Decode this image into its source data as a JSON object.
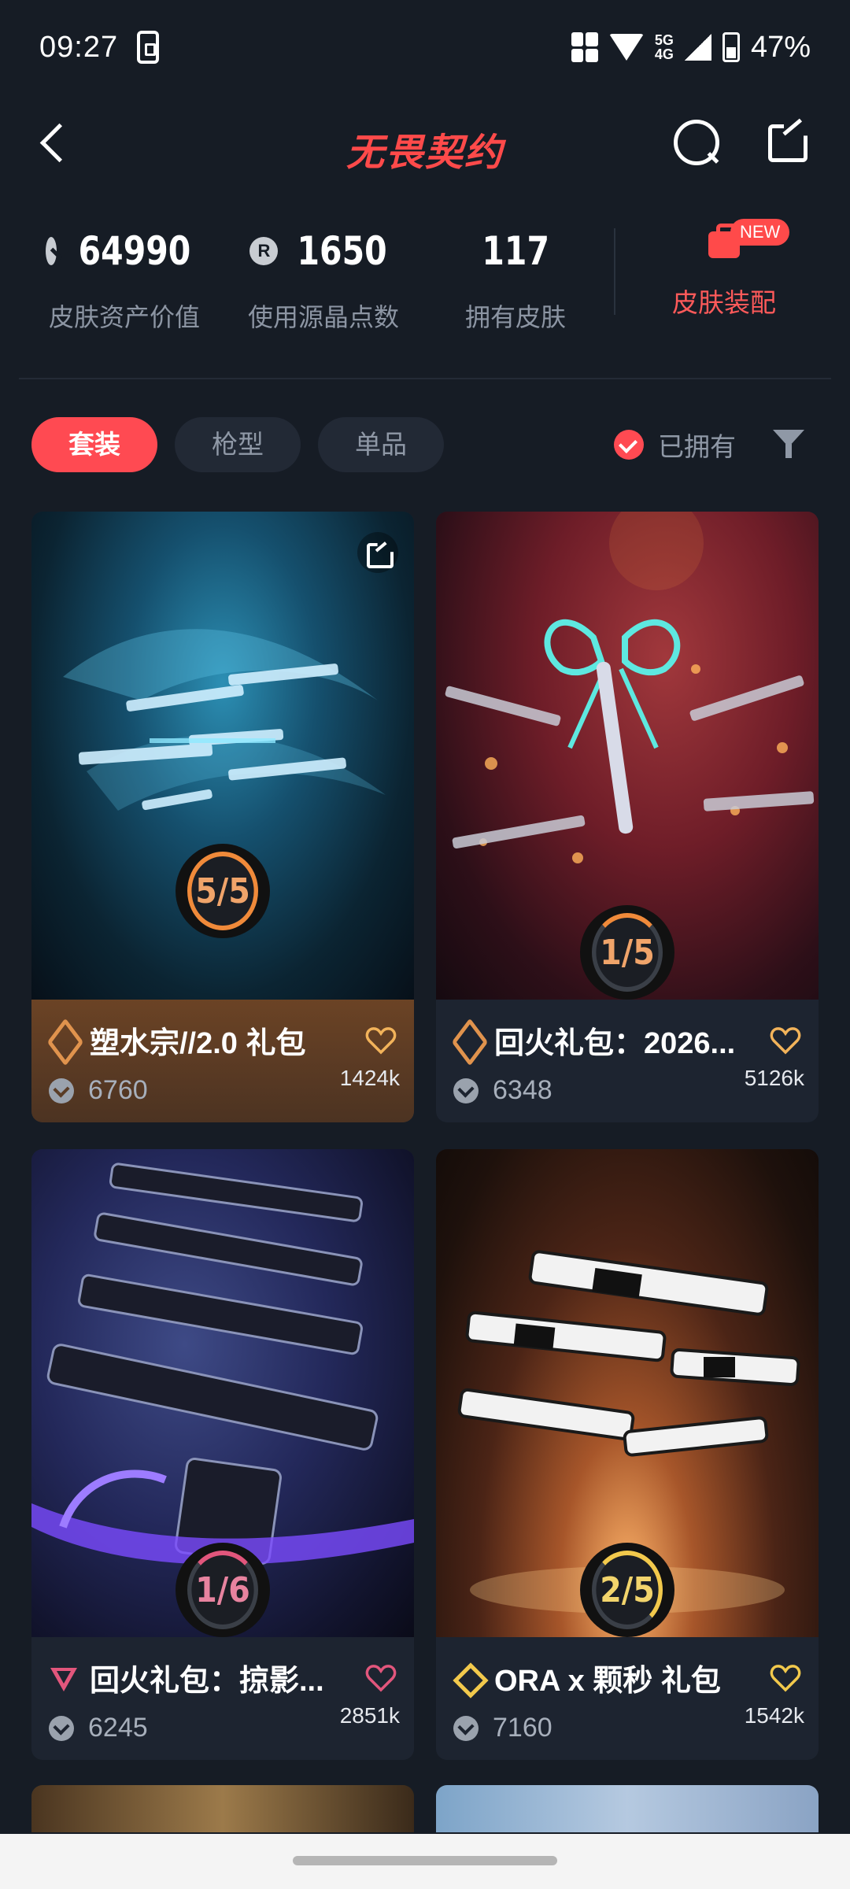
{
  "status_bar": {
    "time": "09:27",
    "battery": "47%",
    "net_top": "5G",
    "net_bottom": "4G"
  },
  "header": {
    "logo": "无畏契约"
  },
  "stats": {
    "asset_value": "64990",
    "asset_label": "皮肤资产价值",
    "rp_points": "1650",
    "rp_label": "使用源晶点数",
    "owned_skins": "117",
    "owned_label": "拥有皮肤",
    "loadout_label": "皮肤装配",
    "new_badge": "NEW"
  },
  "filters": {
    "tabs": [
      {
        "label": "套装",
        "active": true
      },
      {
        "label": "枪型",
        "active": false
      },
      {
        "label": "单品",
        "active": false
      }
    ],
    "owned_label": "已拥有"
  },
  "cards": [
    {
      "name": "塑水宗//2.0 礼包",
      "price": "6760",
      "count": "1424k",
      "progress": "5/5",
      "owned": 5,
      "total": 5,
      "tier": "bronze",
      "ring_color": "#f08a3a"
    },
    {
      "name": "回火礼包：2026...",
      "price": "6348",
      "count": "5126k",
      "progress": "1/5",
      "owned": 1,
      "total": 5,
      "tier": "bronze",
      "ring_color": "#f08a3a"
    },
    {
      "name": "回火礼包：掠影...",
      "price": "6245",
      "count": "2851k",
      "progress": "1/6",
      "owned": 1,
      "total": 6,
      "tier": "pink",
      "ring_color": "#e2567c"
    },
    {
      "name": "ORA x 颗秒 礼包",
      "price": "7160",
      "count": "1542k",
      "progress": "2/5",
      "owned": 2,
      "total": 5,
      "tier": "gold",
      "ring_color": "#f2c94c"
    }
  ],
  "colors": {
    "accent": "#ff4a52",
    "background": "#161c25",
    "card": "#1d2430"
  }
}
